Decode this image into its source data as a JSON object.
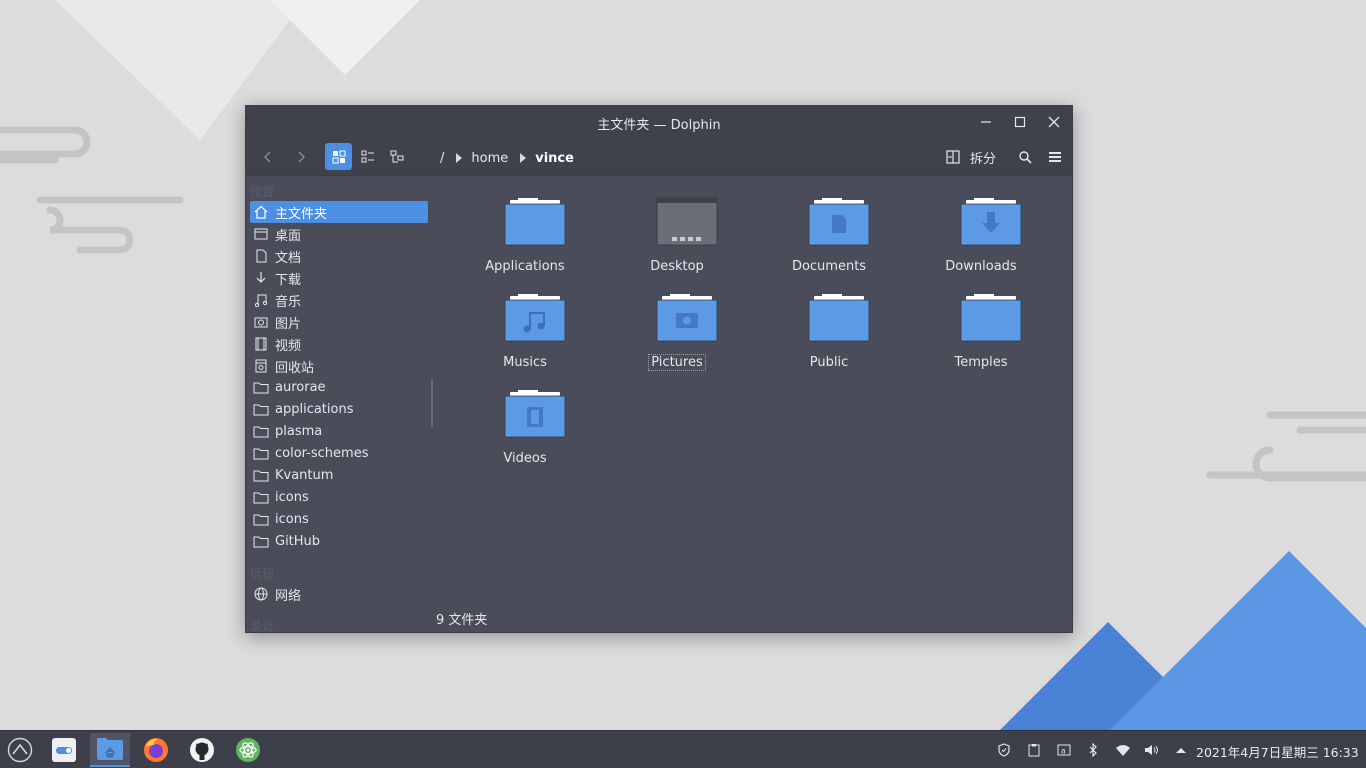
{
  "window": {
    "title": "主文件夹 — Dolphin"
  },
  "breadcrumb": {
    "root": "/",
    "items": [
      "home",
      "vince"
    ]
  },
  "toolbar": {
    "split_label": "拆分"
  },
  "places": {
    "section_places": "位置",
    "section_remote": "远程",
    "section_recent": "最近",
    "items": [
      {
        "label": "主文件夹",
        "icon": "home-icon"
      },
      {
        "label": "桌面",
        "icon": "desktop-icon"
      },
      {
        "label": "文档",
        "icon": "document-icon"
      },
      {
        "label": "下载",
        "icon": "download-icon"
      },
      {
        "label": "音乐",
        "icon": "music-icon"
      },
      {
        "label": "图片",
        "icon": "camera-icon"
      },
      {
        "label": "视频",
        "icon": "film-icon"
      },
      {
        "label": "回收站",
        "icon": "trash-icon"
      },
      {
        "label": "aurorae",
        "icon": "folder-icon"
      },
      {
        "label": "applications",
        "icon": "folder-icon"
      },
      {
        "label": "plasma",
        "icon": "folder-icon"
      },
      {
        "label": "color-schemes",
        "icon": "folder-icon"
      },
      {
        "label": "Kvantum",
        "icon": "folder-icon"
      },
      {
        "label": "icons",
        "icon": "folder-icon"
      },
      {
        "label": "icons",
        "icon": "folder-icon"
      },
      {
        "label": "GitHub",
        "icon": "folder-icon"
      }
    ],
    "remote_items": [
      {
        "label": "网络",
        "icon": "network-icon"
      }
    ]
  },
  "files": [
    {
      "name": "Applications",
      "icon": "folder-icon"
    },
    {
      "name": "Desktop",
      "icon": "desktop-folder-icon"
    },
    {
      "name": "Documents",
      "icon": "documents-folder-icon"
    },
    {
      "name": "Downloads",
      "icon": "downloads-folder-icon"
    },
    {
      "name": "Musics",
      "icon": "music-folder-icon"
    },
    {
      "name": "Pictures",
      "icon": "pictures-folder-icon"
    },
    {
      "name": "Public",
      "icon": "folder-icon"
    },
    {
      "name": "Temples",
      "icon": "folder-icon"
    },
    {
      "name": "Videos",
      "icon": "videos-folder-icon"
    }
  ],
  "status": {
    "text": "9 文件夹"
  },
  "taskbar": {
    "clock": "2021年4月7日星期三 16:33"
  },
  "colors": {
    "accent": "#4c8fe3",
    "folder": "#5d9ae6",
    "window_bg": "#4a4d59",
    "titlebar_bg": "#3f424d",
    "taskbar_bg": "#3d3f4a"
  }
}
